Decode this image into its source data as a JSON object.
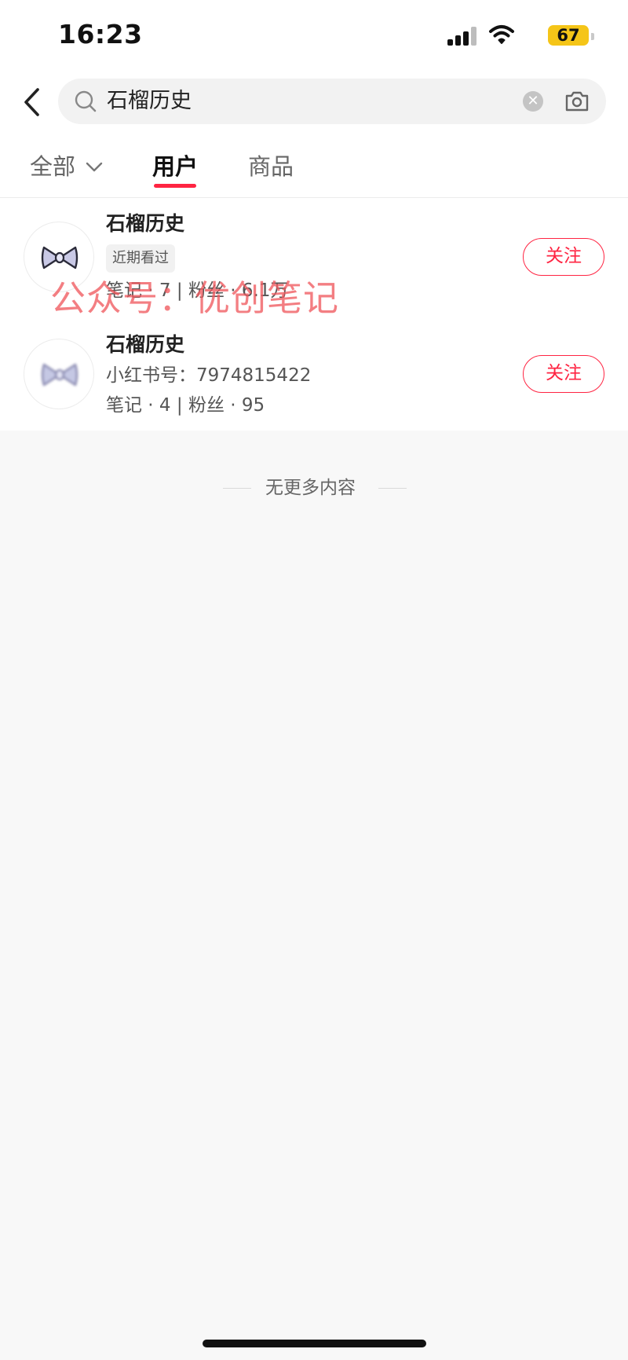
{
  "status_bar": {
    "time": "16:23",
    "battery": "67"
  },
  "search": {
    "query": "石榴历史"
  },
  "tabs": [
    {
      "label": "全部"
    },
    {
      "label": "用户"
    },
    {
      "label": "商品"
    }
  ],
  "results": [
    {
      "name": "石榴历史",
      "badge": "近期看过",
      "stats": "笔记 · 7 | 粉丝 · 6.1万",
      "follow_label": "关注"
    },
    {
      "name": "石榴历史",
      "id_line": "小红书号：7974815422",
      "stats": "笔记 · 4 | 粉丝 · 95",
      "follow_label": "关注"
    }
  ],
  "end_note": "无更多内容",
  "watermark": "公众号：优创笔记",
  "colors": {
    "accent": "#ff2442",
    "background": "#f8f8f8"
  }
}
